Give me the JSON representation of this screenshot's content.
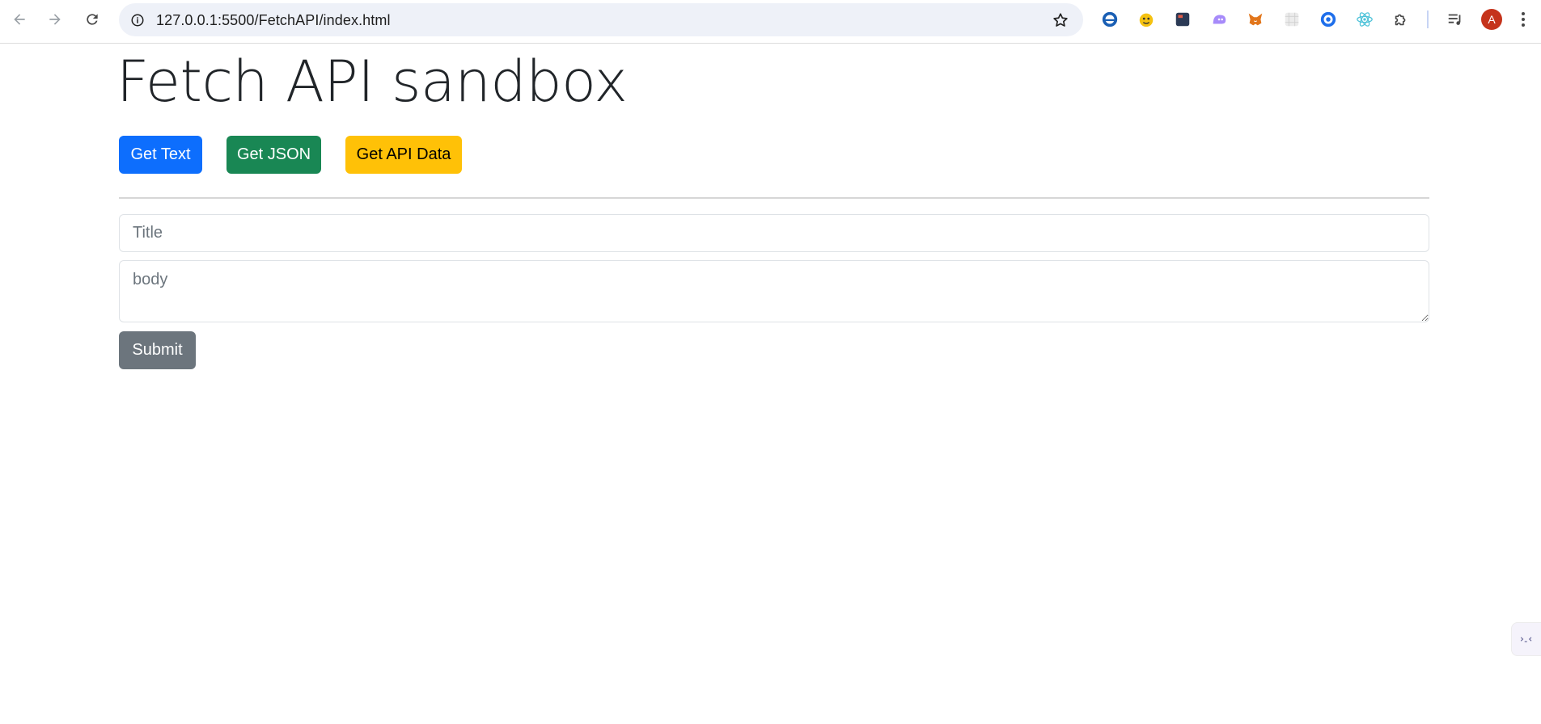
{
  "browser": {
    "url": "127.0.0.1:5500/FetchAPI/index.html",
    "avatar_letter": "A",
    "extensions": [
      {
        "name": "ie-extension-icon",
        "color": "#1a5fb4"
      },
      {
        "name": "honey-extension-icon",
        "color": "#f5c211"
      },
      {
        "name": "dark-panel-extension-icon",
        "color": "#2b3a55"
      },
      {
        "name": "ghost-extension-icon",
        "color": "#a78bfa"
      },
      {
        "name": "metamask-extension-icon",
        "color": "#e2761b"
      },
      {
        "name": "grid-extension-icon",
        "color": "#d8d8d8"
      },
      {
        "name": "target-extension-icon",
        "color": "#1f6feb"
      },
      {
        "name": "react-extension-icon",
        "color": "#4fc3d9"
      },
      {
        "name": "puzzle-extension-icon",
        "color": "#474747"
      }
    ],
    "colors": {
      "avatar": "#c5331b",
      "omnibox": "#eef1f8"
    }
  },
  "page": {
    "title": "Fetch API sandbox",
    "buttons": {
      "get_text": "Get Text",
      "get_json": "Get JSON",
      "get_api_data": "Get API Data"
    },
    "form": {
      "title_placeholder": "Title",
      "body_placeholder": "body",
      "submit_label": "Submit"
    },
    "colors": {
      "primary": "#0d6efd",
      "success": "#198754",
      "warning": "#ffc107",
      "secondary": "#6c757d"
    }
  }
}
